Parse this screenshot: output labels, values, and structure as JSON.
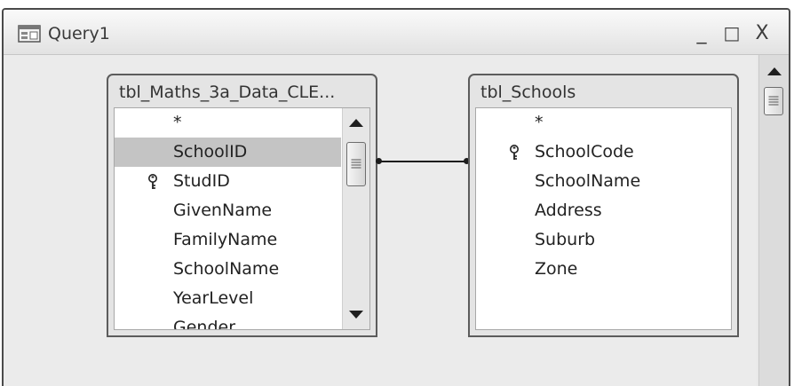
{
  "window": {
    "title": "Query1",
    "minimize_label": "_",
    "maximize_label": "□",
    "close_label": "X"
  },
  "tables": [
    {
      "title": "tbl_Maths_3a_Data_CLE...",
      "fields": [
        {
          "name": "*",
          "key": false,
          "selected": false
        },
        {
          "name": "SchoolID",
          "key": false,
          "selected": true
        },
        {
          "name": "StudID",
          "key": true,
          "selected": false
        },
        {
          "name": "GivenName",
          "key": false,
          "selected": false
        },
        {
          "name": "FamilyName",
          "key": false,
          "selected": false
        },
        {
          "name": "SchoolName",
          "key": false,
          "selected": false
        },
        {
          "name": "YearLevel",
          "key": false,
          "selected": false
        },
        {
          "name": "Gender",
          "key": false,
          "selected": false
        }
      ]
    },
    {
      "title": "tbl_Schools",
      "fields": [
        {
          "name": "*",
          "key": false,
          "selected": false
        },
        {
          "name": "SchoolCode",
          "key": true,
          "selected": false
        },
        {
          "name": "SchoolName",
          "key": false,
          "selected": false
        },
        {
          "name": "Address",
          "key": false,
          "selected": false
        },
        {
          "name": "Suburb",
          "key": false,
          "selected": false
        },
        {
          "name": "Zone",
          "key": false,
          "selected": false
        }
      ]
    }
  ],
  "relationship": {
    "from_field": "SchoolID",
    "to_field": "SchoolCode"
  }
}
